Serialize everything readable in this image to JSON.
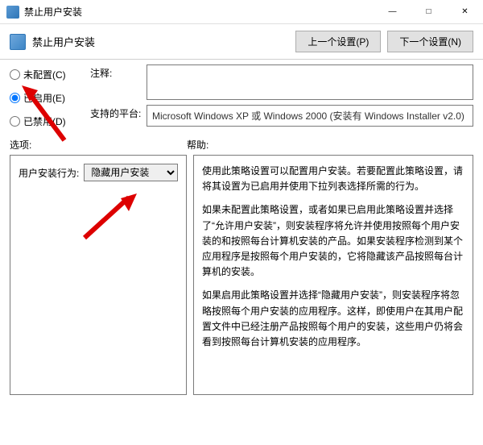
{
  "window": {
    "title": "禁止用户安装",
    "min": "—",
    "max": "□",
    "close": "✕"
  },
  "header": {
    "title": "禁止用户安装",
    "prev_btn": "上一个设置(P)",
    "next_btn": "下一个设置(N)"
  },
  "radios": {
    "not_configured": "未配置(C)",
    "enabled": "已启用(E)",
    "disabled": "已禁用(D)"
  },
  "fields": {
    "comment_label": "注释:",
    "comment_value": "",
    "platform_label": "支持的平台:",
    "platform_value": "Microsoft Windows XP 或 Windows 2000 (安装有 Windows Installer v2.0)"
  },
  "labels": {
    "options": "选项:",
    "help": "帮助:"
  },
  "options_panel": {
    "behavior_label": "用户安装行为:",
    "behavior_value": "隐藏用户安装"
  },
  "help_panel": {
    "p1": "使用此策略设置可以配置用户安装。若要配置此策略设置，请将其设置为已启用并使用下拉列表选择所需的行为。",
    "p2": "如果未配置此策略设置，或者如果已启用此策略设置并选择了“允许用户安装”，则安装程序将允许并使用按照每个用户安装的和按照每台计算机安装的产品。如果安装程序检测到某个应用程序是按照每个用户安装的，它将隐藏该产品按照每台计算机的安装。",
    "p3": "如果启用此策略设置并选择“隐藏用户安装”，则安装程序将忽略按照每个用户安装的应用程序。这样，即使用户在其用户配置文件中已经注册产品按照每个用户的安装，这些用户仍将会看到按照每台计算机安装的应用程序。"
  }
}
